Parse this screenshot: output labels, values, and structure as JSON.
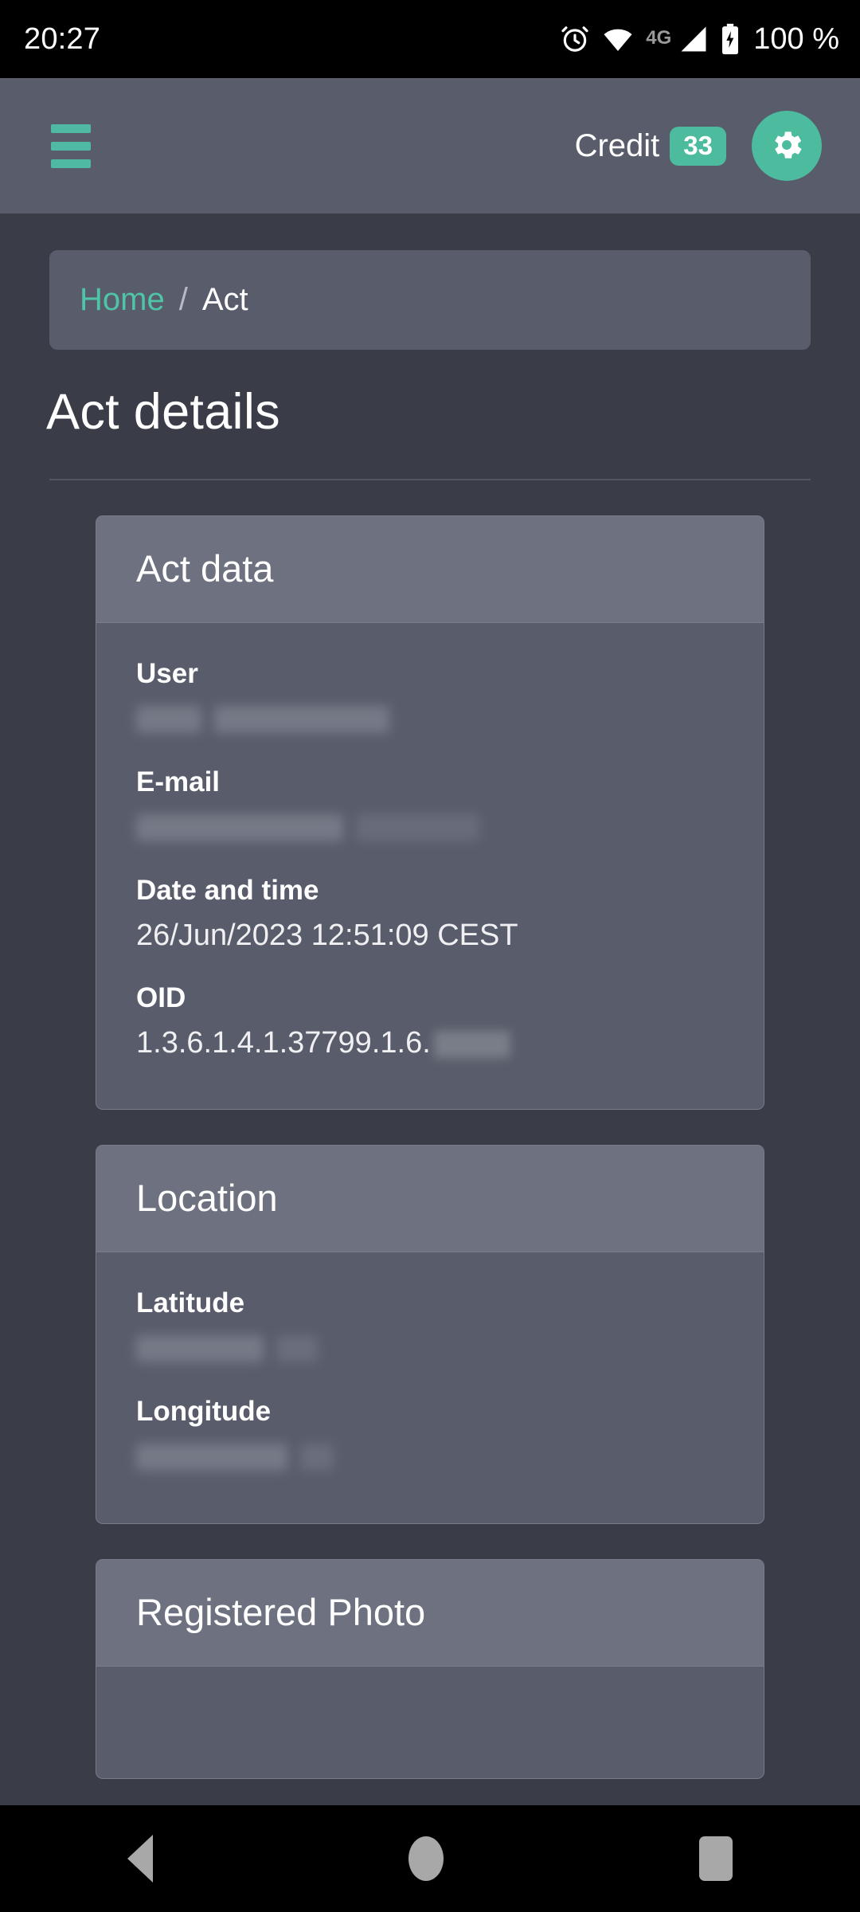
{
  "statusbar": {
    "time": "20:27",
    "network_label": "4G",
    "battery_percent": "100 %",
    "icons": [
      "alarm-clock-icon",
      "wifi-icon",
      "signal-icon",
      "battery-charging-icon"
    ]
  },
  "appbar": {
    "menu_icon": "hamburger-menu-icon",
    "credit_label": "Credit",
    "credit_value": "33",
    "settings_icon": "gear-icon"
  },
  "breadcrumb": {
    "home": "Home",
    "separator": "/",
    "current": "Act"
  },
  "page": {
    "title": "Act details"
  },
  "cards": [
    {
      "title": "Act data",
      "fields": [
        {
          "label": "User",
          "value": "",
          "redacted": true
        },
        {
          "label": "E-mail",
          "value": "",
          "redacted": true
        },
        {
          "label": "Date and time",
          "value": "26/Jun/2023 12:51:09 CEST",
          "redacted": false
        },
        {
          "label": "OID",
          "value": "1.3.6.1.4.1.37799.1.6.",
          "redacted": "partial"
        }
      ]
    },
    {
      "title": "Location",
      "fields": [
        {
          "label": "Latitude",
          "value": "",
          "redacted": true
        },
        {
          "label": "Longitude",
          "value": "",
          "redacted": true
        }
      ]
    },
    {
      "title": "Registered Photo",
      "fields": []
    }
  ],
  "navbar": {
    "back": "back-icon",
    "home": "home-icon",
    "recents": "recents-icon"
  },
  "colors": {
    "accent": "#4dbb9e",
    "page_bg": "#3a3c47",
    "appbar_bg": "#585c6b",
    "card_bg": "#595d6b",
    "card_header_bg": "#6e7280",
    "link": "#4fc5a8"
  }
}
